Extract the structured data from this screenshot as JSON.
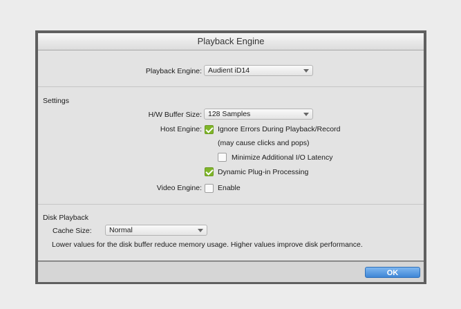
{
  "dialog": {
    "title": "Playback Engine"
  },
  "engine": {
    "label": "Playback Engine:",
    "value": "Audient iD14"
  },
  "settings": {
    "heading": "Settings",
    "buffer_label": "H/W Buffer Size:",
    "buffer_value": "128 Samples",
    "host_label": "Host Engine:",
    "ignore_errors_label": "Ignore Errors During Playback/Record",
    "ignore_errors_checked": true,
    "ignore_errors_note": "(may cause clicks and pops)",
    "minimize_latency_label": "Minimize Additional I/O Latency",
    "minimize_latency_checked": false,
    "dynamic_plugin_label": "Dynamic Plug-in Processing",
    "dynamic_plugin_checked": true,
    "video_label": "Video Engine:",
    "video_enable_label": "Enable",
    "video_enable_checked": false
  },
  "disk": {
    "heading": "Disk Playback",
    "cache_label": "Cache Size:",
    "cache_value": "Normal",
    "description": "Lower values for the disk buffer reduce memory usage.  Higher values improve disk performance."
  },
  "footer": {
    "ok_label": "OK"
  },
  "colors": {
    "checkbox_on": "#7fb52a",
    "ok_button": "#3f86d6",
    "frame": "#5f5f5f"
  }
}
